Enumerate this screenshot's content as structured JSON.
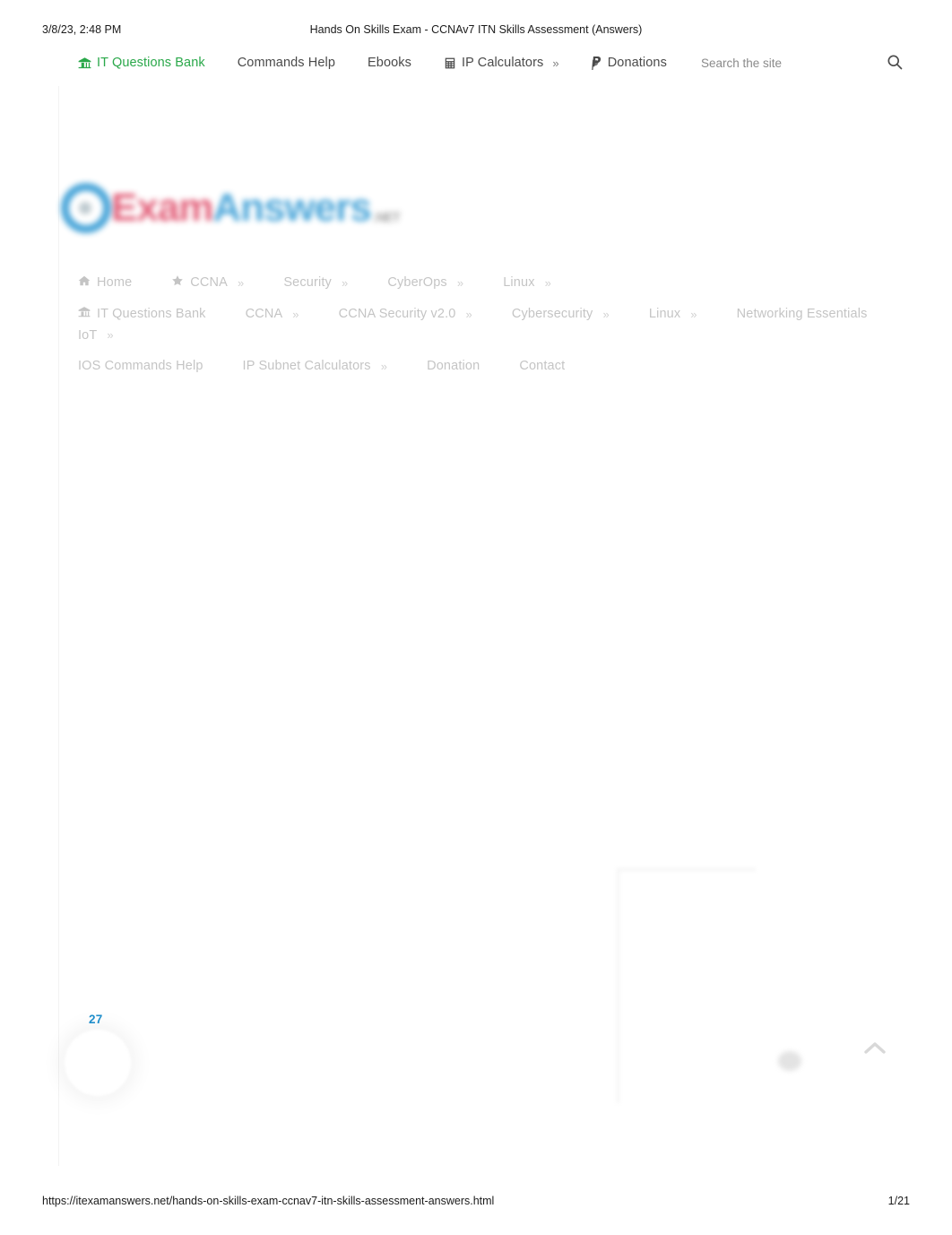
{
  "print": {
    "date": "3/8/23, 2:48 PM",
    "doc_title": "Hands On Skills Exam - CCNAv7 ITN Skills Assessment (Answers)",
    "url": "https://itexamanswers.net/hands-on-skills-exam-ccnav7-itn-skills-assessment-answers.html",
    "page_number": "1/21"
  },
  "colors": {
    "accent_green": "#2aa84a",
    "logo_blue": "#3d9fd6",
    "logo_pink": "#e0536f",
    "share_blue": "#1f8ecb",
    "text_dark": "#1b1b1b",
    "text_muted": "#6d6d6d"
  },
  "topbar": {
    "items": [
      {
        "label": "IT Questions Bank",
        "icon": "bank-icon",
        "accent": true,
        "chevron": ""
      },
      {
        "label": "Commands Help",
        "icon": "",
        "accent": false,
        "chevron": ""
      },
      {
        "label": "Ebooks",
        "icon": "",
        "accent": false,
        "chevron": ""
      },
      {
        "label": "IP Calculators",
        "icon": "calculator-icon",
        "accent": false,
        "chevron": "»"
      },
      {
        "label": "Donations",
        "icon": "paypal-icon",
        "accent": false,
        "chevron": ""
      }
    ],
    "search": {
      "placeholder": "Search the site",
      "value": "",
      "icon": "search-icon"
    }
  },
  "logo": {
    "mark_icon": "circle-logo-icon",
    "part_exam": "Exam",
    "part_answers": "Answers",
    "tld": ".NET"
  },
  "menu": {
    "row1": [
      {
        "label": "Home",
        "icon": "home-icon",
        "chevron": ""
      },
      {
        "label": "CCNA",
        "icon": "star-icon",
        "chevron": "»"
      },
      {
        "label": "Security",
        "icon": "",
        "chevron": "»"
      },
      {
        "label": "CyberOps",
        "icon": "",
        "chevron": "»"
      },
      {
        "label": "Linux",
        "icon": "",
        "chevron": "»"
      }
    ],
    "row2": [
      {
        "label": "IT Questions Bank",
        "icon": "bank-icon",
        "chevron": ""
      },
      {
        "label": "CCNA",
        "icon": "",
        "chevron": "»"
      },
      {
        "label": "CCNA Security v2.0",
        "icon": "",
        "chevron": "»"
      },
      {
        "label": "Cybersecurity",
        "icon": "",
        "chevron": "»"
      },
      {
        "label": "Linux",
        "icon": "",
        "chevron": "»"
      },
      {
        "label": "Networking Essentials",
        "icon": "",
        "chevron": ""
      },
      {
        "label": "IoT",
        "icon": "",
        "chevron": "»"
      }
    ],
    "row3": [
      {
        "label": "IOS Commands Help",
        "icon": "",
        "chevron": ""
      },
      {
        "label": "IP Subnet Calculators",
        "icon": "",
        "chevron": "»"
      },
      {
        "label": "Donation",
        "icon": "",
        "chevron": ""
      },
      {
        "label": "Contact",
        "icon": "",
        "chevron": ""
      }
    ]
  },
  "widgets": {
    "share_count": "27",
    "scroll_top_icon": "chevron-up-icon"
  }
}
